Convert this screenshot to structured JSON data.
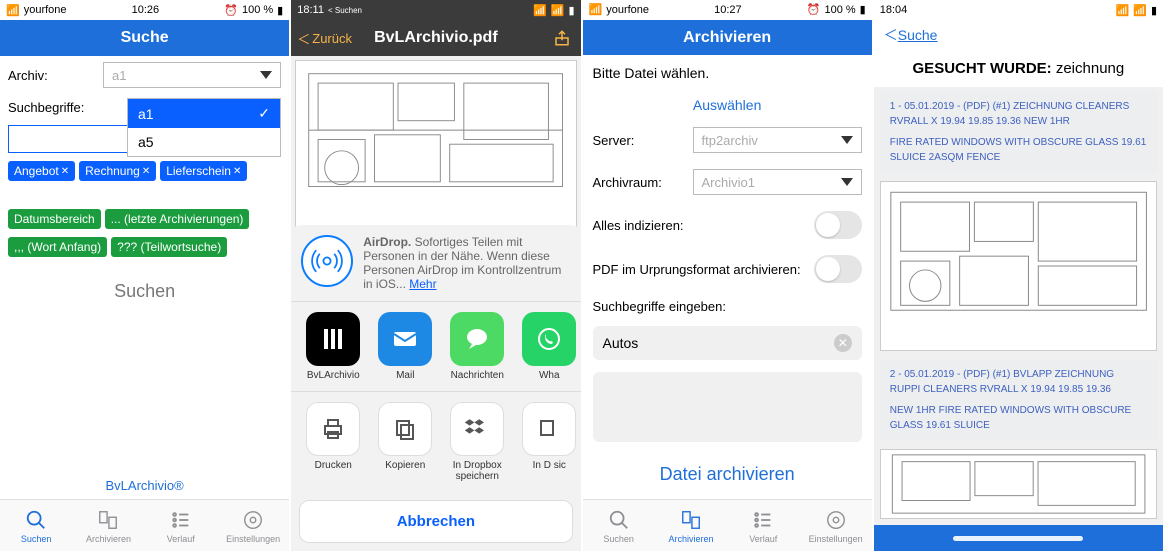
{
  "s1": {
    "status": {
      "carrier": "yourfone",
      "time": "10:26",
      "alarm": "⏰",
      "battery": "100 %"
    },
    "title": "Suche",
    "archiv_label": "Archiv:",
    "archiv_value": "a1",
    "such_label": "Suchbegriffe:",
    "dropdown": {
      "opt1": "a1",
      "opt2": "a5"
    },
    "chips_blue": [
      "Angebot",
      "Rechnung",
      "Lieferschein"
    ],
    "chips_green": [
      "Datumsbereich",
      "... (letzte Archivierungen)",
      ",,, (Wort Anfang)",
      "??? (Teilwortsuche)"
    ],
    "search_btn": "Suchen",
    "brand": "BvLArchivio®",
    "tabs": [
      "Suchen",
      "Archivieren",
      "Verlauf",
      "Einstellungen"
    ]
  },
  "s2": {
    "status": {
      "time": "18:11",
      "sub": "< Suchen"
    },
    "back": "Zurück",
    "title": "BvLArchivio.pdf",
    "airdrop_title": "AirDrop.",
    "airdrop_text": " Sofortiges Teilen mit Personen in der Nähe. Wenn diese Personen AirDrop im Kontrollzentrum in iOS... ",
    "airdrop_more": "Mehr",
    "share_items": [
      "BvLArchivio",
      "Mail",
      "Nachrichten",
      "Wha"
    ],
    "action_items": [
      "Drucken",
      "Kopieren",
      "In Dropbox speichern",
      "In D sic"
    ],
    "cancel": "Abbrechen"
  },
  "s3": {
    "status": {
      "carrier": "yourfone",
      "time": "10:27",
      "battery": "100 %"
    },
    "title": "Archivieren",
    "choose_text": "Bitte Datei wählen.",
    "choose_link": "Auswählen",
    "server_label": "Server:",
    "server_value": "ftp2archiv",
    "archiv_label": "Archivraum:",
    "archiv_value": "Archivio1",
    "index_label": "Alles indizieren:",
    "pdf_label": "PDF im Urprungsformat archivieren:",
    "such_label": "Suchbegriffe eingeben:",
    "such_value": "Autos",
    "submit": "Datei archivieren",
    "tabs": [
      "Suchen",
      "Archivieren",
      "Verlauf",
      "Einstellungen"
    ]
  },
  "s4": {
    "status": {
      "time": "18:04"
    },
    "back": "Suche",
    "header_prefix": "GESUCHT WURDE: ",
    "header_term": "zeichnung",
    "r1a": "1 - 05.01.2019 - (PDF) (#1) ZEICHNUNG CLEANERS RVRALL X 19.94 19.85 19.36 NEW 1HR",
    "r1b": "FIRE RATED WINDOWS WITH OBSCURE GLASS 19.61 SLUICE 2ASQM FENCE",
    "r2a": "2 - 05.01.2019 - (PDF) (#1) BVLAPP ZEICHNUNG RUPPI CLEANERS RVRALL X 19.94 19.85 19.36",
    "r2b": "NEW 1HR FIRE RATED WINDOWS WITH OBSCURE GLASS 19.61 SLUICE"
  }
}
